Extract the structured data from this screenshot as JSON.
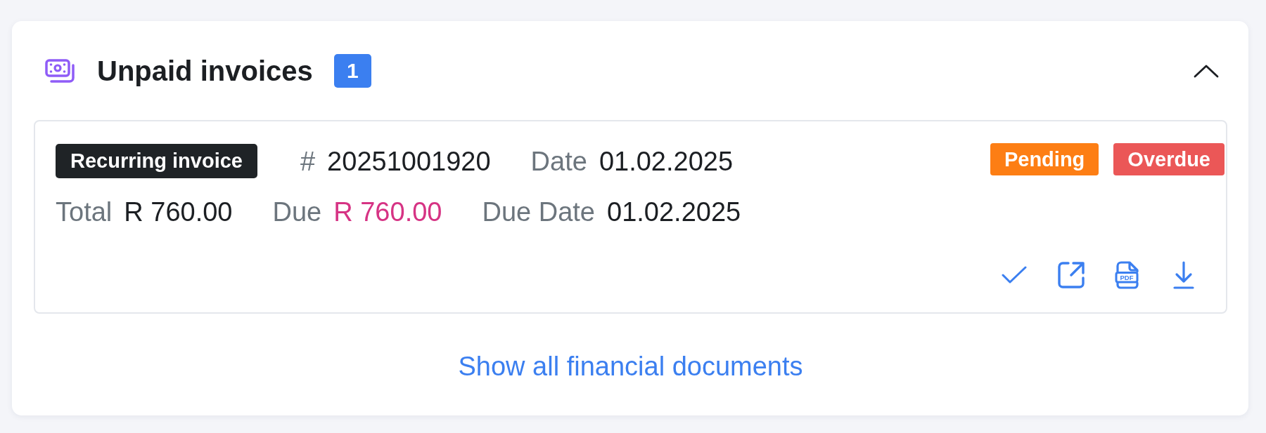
{
  "panel": {
    "title": "Unpaid invoices",
    "count": "1",
    "expanded": true
  },
  "invoices": [
    {
      "type_label": "Recurring invoice",
      "number": {
        "label": "#",
        "value": "20251001920"
      },
      "date": {
        "label": "Date",
        "value": "01.02.2025"
      },
      "total": {
        "label": "Total",
        "value": "R 760.00"
      },
      "due": {
        "label": "Due",
        "value": "R 760.00"
      },
      "due_date": {
        "label": "Due Date",
        "value": "01.02.2025"
      },
      "statuses": [
        {
          "label": "Pending",
          "color": "#fd7e14"
        },
        {
          "label": "Overdue",
          "color": "#eb5757"
        }
      ],
      "pdf_label": "PDF"
    }
  ],
  "footer_link": "Show all financial documents"
}
